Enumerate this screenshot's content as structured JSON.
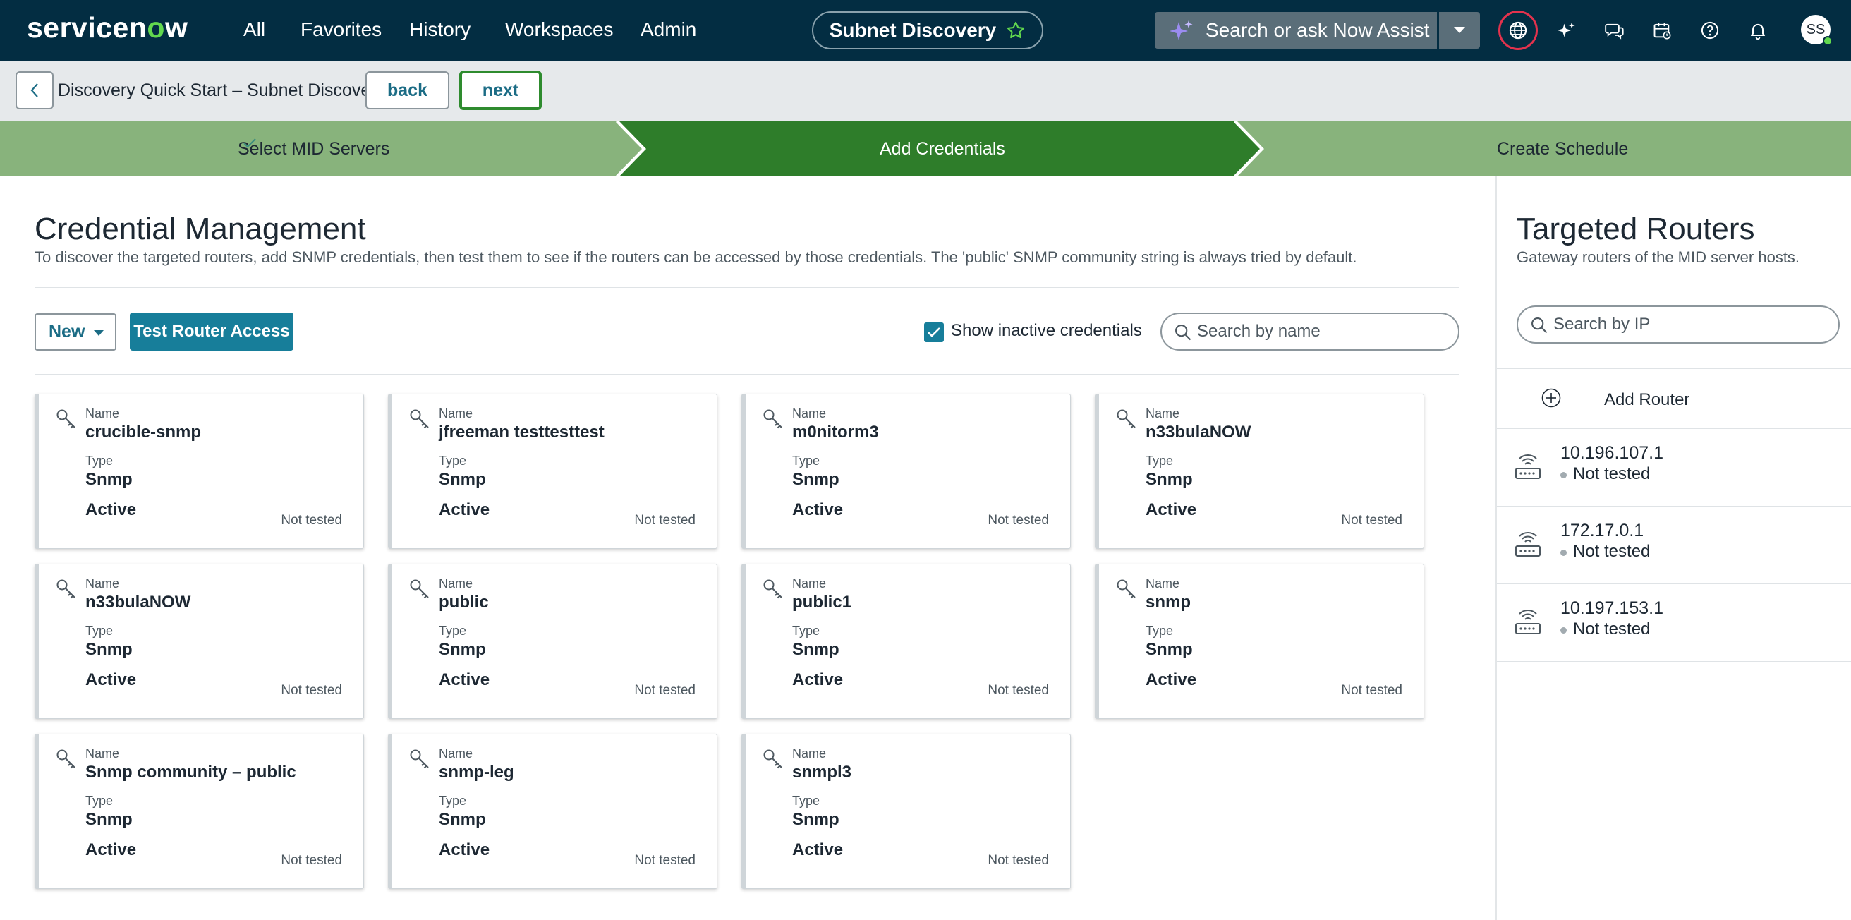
{
  "topnav": {
    "logo_pre": "servicen",
    "logo_accent": "o",
    "logo_post": "w",
    "items": [
      "All",
      "Favorites",
      "History",
      "Workspaces",
      "Admin"
    ],
    "context": "Subnet Discovery",
    "assist_placeholder": "Search or ask Now Assist",
    "avatar_initials": "SS",
    "icons": [
      "sparkle-icon",
      "chevron-down-icon",
      "globe-icon",
      "ai-sparkle-icon",
      "chat-icon",
      "calendar-icon",
      "help-icon",
      "bell-icon"
    ]
  },
  "subheader": {
    "breadcrumb": "Discovery Quick Start – Subnet Discovery",
    "back_label": "back",
    "next_label": "next"
  },
  "stepper": {
    "steps": [
      {
        "label": "Select MID Servers",
        "state": "complete"
      },
      {
        "label": "Add Credentials",
        "state": "active"
      },
      {
        "label": "Create Schedule",
        "state": "upcoming"
      }
    ],
    "colors": {
      "complete": "#88b37c",
      "active": "#2e7d2a",
      "upcoming": "#88b37c"
    }
  },
  "main": {
    "title": "Credential Management",
    "description": "To discover the targeted routers, add SNMP credentials, then test them to see if the routers can be accessed by those credentials. The 'public' SNMP community string is always tried by default.",
    "new_label": "New",
    "test_label": "Test Router Access",
    "show_inactive_label": "Show inactive credentials",
    "show_inactive_checked": true,
    "search_placeholder": "Search by name"
  },
  "card_labels": {
    "name": "Name",
    "type": "Type"
  },
  "credentials": [
    {
      "name": "crucible-snmp",
      "type": "Snmp",
      "active": "Active",
      "status": "Not tested"
    },
    {
      "name": "jfreeman testtesttest",
      "type": "Snmp",
      "active": "Active",
      "status": "Not tested"
    },
    {
      "name": "m0nitorm3",
      "type": "Snmp",
      "active": "Active",
      "status": "Not tested"
    },
    {
      "name": "n33bulaNOW",
      "type": "Snmp",
      "active": "Active",
      "status": "Not tested"
    },
    {
      "name": "n33bulaNOW",
      "type": "Snmp",
      "active": "Active",
      "status": "Not tested"
    },
    {
      "name": "public",
      "type": "Snmp",
      "active": "Active",
      "status": "Not tested"
    },
    {
      "name": "public1",
      "type": "Snmp",
      "active": "Active",
      "status": "Not tested"
    },
    {
      "name": "snmp",
      "type": "Snmp",
      "active": "Active",
      "status": "Not tested"
    },
    {
      "name": "Snmp community – public",
      "type": "Snmp",
      "active": "Active",
      "status": "Not tested"
    },
    {
      "name": "snmp-leg",
      "type": "Snmp",
      "active": "Active",
      "status": "Not tested"
    },
    {
      "name": "snmpl3",
      "type": "Snmp",
      "active": "Active",
      "status": "Not tested"
    }
  ],
  "routers_panel": {
    "title": "Targeted Routers",
    "subtitle": "Gateway routers of the MID server hosts.",
    "search_placeholder": "Search by IP",
    "add_label": "Add Router",
    "routers": [
      {
        "ip": "10.196.107.1",
        "status": "Not tested"
      },
      {
        "ip": "172.17.0.1",
        "status": "Not tested"
      },
      {
        "ip": "10.197.153.1",
        "status": "Not tested"
      }
    ]
  }
}
